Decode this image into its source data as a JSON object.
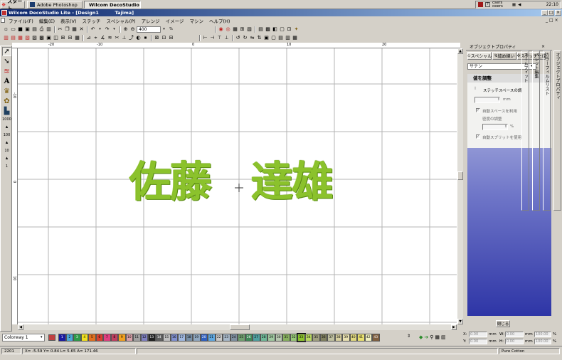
{
  "taskbar": {
    "start": "スタート",
    "tasks": [
      "Adobe Photoshop",
      "Wilcom DecoStudio ..."
    ],
    "tray_user_top": "csers",
    "tray_user_bottom": "ceers",
    "clock": "22:10"
  },
  "window": {
    "title": "Wilcom DecoStudio Lite - [Design1          Tajima]"
  },
  "menu": [
    "ファイル(F)",
    "編集(E)",
    "表示(V)",
    "ステッチ",
    "スペシャル(P)",
    "アレンジ",
    "イメージ",
    "マシン",
    "ヘルプ(H)"
  ],
  "toolbar": {
    "zoom_value": "400"
  },
  "toolbox": {
    "numbers": [
      "1000",
      "100",
      "10",
      "1"
    ]
  },
  "rulers": {
    "h_labels": [
      "-20",
      "-10",
      "0",
      "10",
      "20"
    ],
    "v_labels": [
      "-10",
      "0",
      "10"
    ]
  },
  "canvas": {
    "embroidery_left": "佐藤",
    "embroidery_right": "達雄",
    "thread_color": "#8bc22c"
  },
  "panel": {
    "title": "オブジェクトプロパティ",
    "tabs": [
      "スペシャル",
      "縫め線い",
      "ステッチ生成"
    ],
    "stitch_type": "サテン",
    "section_title": "値を調整",
    "stitch_spacing_label": "ステッチスペースの調",
    "unit_mm": "mm",
    "auto_spacing": "自動スペースを利用",
    "density_adjust": "密度の調整",
    "unit_percent": "%",
    "auto_split": "自動スプリットを使用",
    "close_button": "閉じる",
    "vertical_tabs": [
      "オブジェクトプロパティ",
      "カラーフィルムリスト",
      "パレット編集",
      "ズームフィット"
    ]
  },
  "colorbar": {
    "colorway": "Colorway 1",
    "swatches": [
      {
        "n": "1",
        "c": "#1a1aa0"
      },
      {
        "n": "2",
        "c": "#4aa8d8"
      },
      {
        "n": "3",
        "c": "#2f9a4a"
      },
      {
        "n": "4",
        "c": "#f0e020"
      },
      {
        "n": "5",
        "c": "#e07020"
      },
      {
        "n": "6",
        "c": "#d84030"
      },
      {
        "n": "7",
        "c": "#e04080"
      },
      {
        "n": "8",
        "c": "#c04060"
      },
      {
        "n": "9",
        "c": "#f0a020"
      },
      {
        "n": "10",
        "c": "#d8a0a8"
      },
      {
        "n": "11",
        "c": "#a0a0a0"
      },
      {
        "n": "12",
        "c": "#8080c0"
      },
      {
        "n": "13",
        "c": "#202020"
      },
      {
        "n": "14",
        "c": "#606060"
      },
      {
        "n": "15",
        "c": "#c0c0c0"
      },
      {
        "n": "16",
        "c": "#8090d0"
      },
      {
        "n": "17",
        "c": "#a0b8e0"
      },
      {
        "n": "18",
        "c": "#7890a8"
      },
      {
        "n": "19",
        "c": "#90a8c0"
      },
      {
        "n": "20",
        "c": "#3060c0"
      },
      {
        "n": "21",
        "c": "#60a8e0"
      },
      {
        "n": "22",
        "c": "#c8c8c8"
      },
      {
        "n": "23",
        "c": "#a8b8c8"
      },
      {
        "n": "24",
        "c": "#8090a0"
      },
      {
        "n": "25",
        "c": "#70a070"
      },
      {
        "n": "26",
        "c": "#408858"
      },
      {
        "n": "27",
        "c": "#50a0a0"
      },
      {
        "n": "28",
        "c": "#70b898"
      },
      {
        "n": "29",
        "c": "#a0c8a0"
      },
      {
        "n": "30",
        "c": "#b8c8b0"
      },
      {
        "n": "31",
        "c": "#88b060"
      },
      {
        "n": "32",
        "c": "#98c878"
      },
      {
        "n": "33",
        "c": "#8bc22c"
      },
      {
        "n": "34",
        "c": "#b8d860"
      },
      {
        "n": "35",
        "c": "#a0a080"
      },
      {
        "n": "36",
        "c": "#808060"
      },
      {
        "n": "37",
        "c": "#c0c0a0"
      },
      {
        "n": "38",
        "c": "#d8d0a0"
      },
      {
        "n": "39",
        "c": "#e8e0b0"
      },
      {
        "n": "40",
        "c": "#e0d880"
      },
      {
        "n": "41",
        "c": "#e8e070"
      },
      {
        "n": "42",
        "c": "#f0f0c0"
      },
      {
        "n": "43",
        "c": "#806040"
      }
    ]
  },
  "coords": {
    "x_label": "X:",
    "y_label": "Y:",
    "w_label": "W:",
    "h_label": "H:",
    "x_value": "0.00",
    "y_value": "0.00",
    "w_value": "0.00",
    "h_value": "0.00",
    "unit": "mm",
    "pct_w": "100.00",
    "pct_h": "100.00",
    "pct": "%"
  },
  "status": {
    "stitch_count": "2201",
    "position": "X= -5.59  Y= 0.84  L= 5.65  A= 171.46",
    "fabric": "Pure Cotton"
  }
}
